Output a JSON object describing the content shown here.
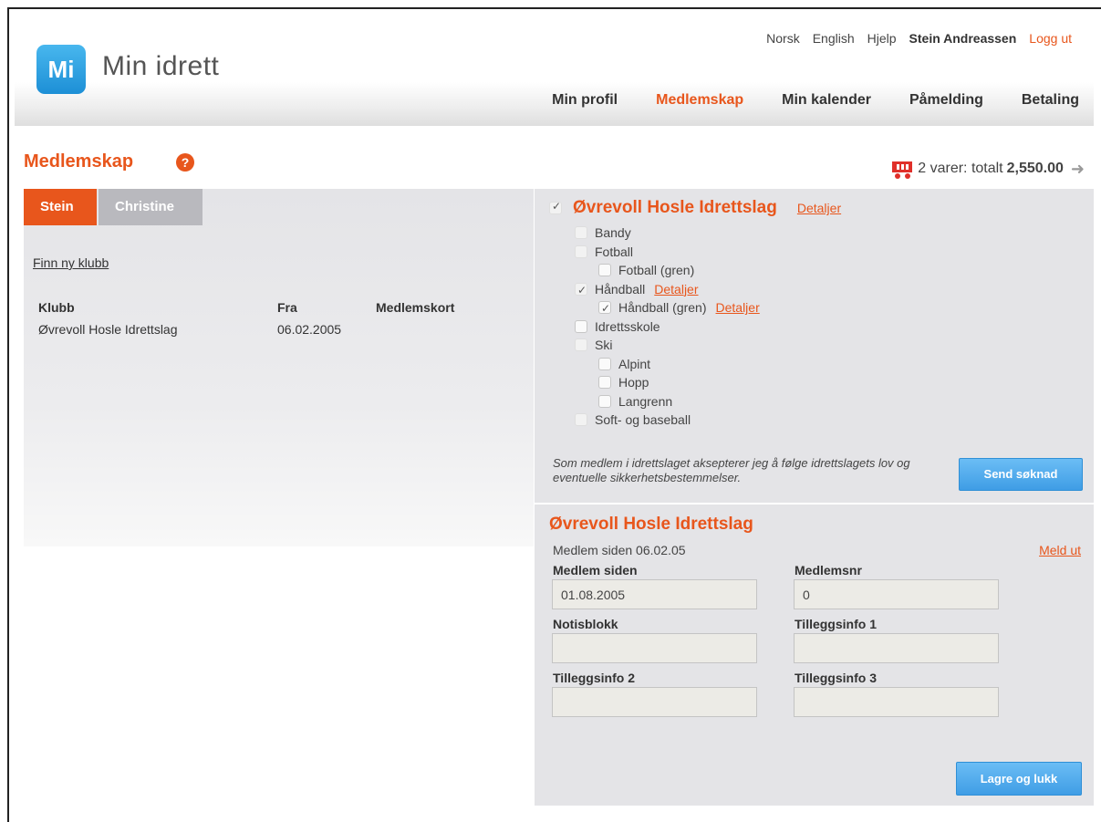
{
  "header": {
    "logo_mark": "Mi",
    "app_name": "Min idrett",
    "util_links": {
      "norsk": "Norsk",
      "english": "English",
      "help": "Hjelp",
      "user": "Stein Andreassen",
      "logout": "Logg ut"
    },
    "nav": {
      "profile": "Min profil",
      "membership": "Medlemskap",
      "calendar": "Min kalender",
      "signup": "Påmelding",
      "payment": "Betaling"
    }
  },
  "page": {
    "title": "Medlemskap",
    "help_icon": "question-icon",
    "cart_prefix": "2 varer: totalt",
    "cart_total": "2,550.00"
  },
  "left": {
    "tabs": [
      "Stein",
      "Christine"
    ],
    "find_club": "Finn ny klubb",
    "table": {
      "headers": [
        "Klubb",
        "Fra",
        "Medlemskort"
      ],
      "rows": [
        [
          "Øvrevoll Hosle Idrettslag",
          "06.02.2005",
          ""
        ]
      ]
    }
  },
  "club_selection": {
    "club_name": "Øvrevoll Hosle Idrettslag",
    "details": "Detaljer",
    "items": [
      {
        "label": "Bandy",
        "level": 1,
        "checked": false,
        "dim": true
      },
      {
        "label": "Fotball",
        "level": 1,
        "checked": false,
        "dim": true
      },
      {
        "label": "Fotball (gren)",
        "level": 2,
        "checked": false,
        "dim": false
      },
      {
        "label": "Håndball",
        "level": 1,
        "checked": true,
        "dim": true,
        "details": "Detaljer"
      },
      {
        "label": "Håndball (gren)",
        "level": 2,
        "checked": true,
        "dim": false,
        "details": "Detaljer"
      },
      {
        "label": "Idrettsskole",
        "level": 1,
        "checked": false,
        "dim": false
      },
      {
        "label": "Ski",
        "level": 1,
        "checked": false,
        "dim": true
      },
      {
        "label": "Alpint",
        "level": 2,
        "checked": false,
        "dim": false
      },
      {
        "label": "Hopp",
        "level": 2,
        "checked": false,
        "dim": false
      },
      {
        "label": "Langrenn",
        "level": 2,
        "checked": false,
        "dim": false
      },
      {
        "label": "Soft- og baseball",
        "level": 1,
        "checked": false,
        "dim": true
      }
    ],
    "accept_text": "Som medlem i idrettslaget aksepterer jeg å følge idrettslagets lov og eventuelle sikkerhetsbestemmelser.",
    "send_button": "Send søknad"
  },
  "membership_detail": {
    "club_name": "Øvrevoll Hosle Idrettslag",
    "member_since_text": "Medlem siden 06.02.05",
    "leave": "Meld ut",
    "fields": {
      "member_since_label": "Medlem siden",
      "member_since_value": "01.08.2005",
      "member_no_label": "Medlemsnr",
      "member_no_value": "0",
      "notes_label": "Notisblokk",
      "notes_value": "",
      "extra1_label": "Tilleggsinfo 1",
      "extra1_value": "",
      "extra2_label": "Tilleggsinfo 2",
      "extra2_value": "",
      "extra3_label": "Tilleggsinfo 3",
      "extra3_value": ""
    },
    "save_button": "Lagre og lukk"
  }
}
